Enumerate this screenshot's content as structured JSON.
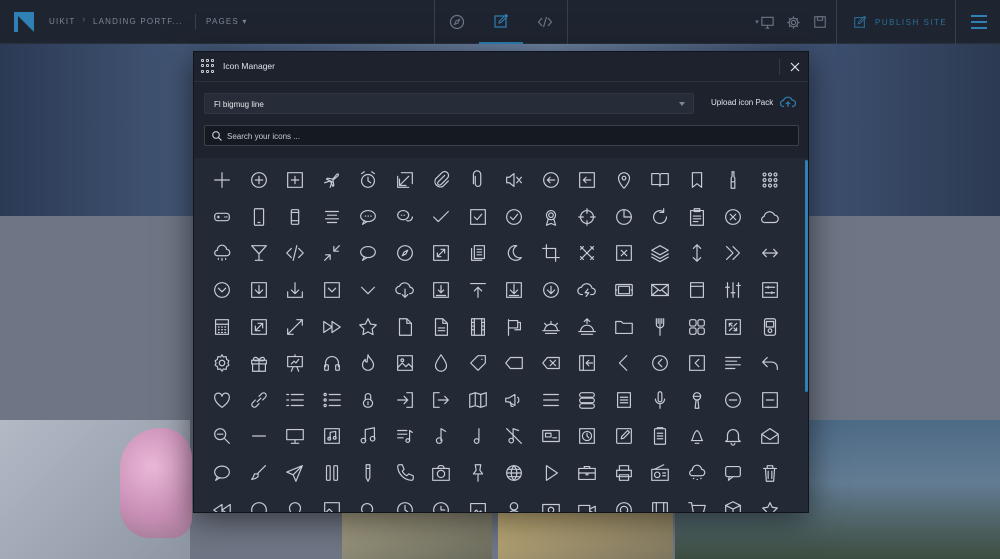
{
  "topbar": {
    "breadcrumb": [
      "UIKIT",
      "LANDING PORTF..."
    ],
    "pages_label": "PAGES",
    "publish_label": "PUBLISH SITE",
    "accent": "#2f80b5",
    "center_tabs": [
      "compass-icon",
      "edit-icon",
      "code-icon"
    ],
    "tools": [
      "device-icon",
      "gear-icon",
      "save-icon"
    ]
  },
  "modal": {
    "title": "Icon Manager",
    "pack_selected": "Fl bigmug line",
    "upload_label": "Upload icon Pack",
    "search_placeholder": "Search your icons ..."
  },
  "icons": [
    "plus",
    "plus-circle",
    "plus-square",
    "airplane",
    "alarm-clock",
    "arrow-down-left-square",
    "paperclip",
    "paperclip-alt",
    "mute",
    "arrow-left-circle",
    "arrow-left-square",
    "location-pin",
    "book-open",
    "bookmark",
    "bottle",
    "keypad",
    "gamepad",
    "mobile",
    "mobile-alt",
    "align-center",
    "chat-bubble",
    "chat-bubbles",
    "check",
    "check-square",
    "check-circle",
    "award",
    "crosshair",
    "pie-chart",
    "refresh",
    "clipboard",
    "close-circle",
    "cloud",
    "cloud-rain",
    "cocktail",
    "code",
    "collapse",
    "speech-bubble",
    "compass",
    "compress-square",
    "documents",
    "moon",
    "crop",
    "cross",
    "close-square",
    "layers",
    "arrow-up-down",
    "chevrons-right",
    "arrow-left-right",
    "chevron-down-circle",
    "download-square",
    "download-box",
    "chevron-down-square",
    "chevron-down",
    "cloud-download",
    "download-tray",
    "upload-bar",
    "download-frame",
    "arrow-down-circle",
    "cloud-lightning",
    "tv",
    "mail",
    "frame",
    "sliders",
    "sliders-box",
    "calculator",
    "expand",
    "expand-arrows",
    "fast-forward",
    "star",
    "file",
    "file-alt",
    "film",
    "flag",
    "sunset",
    "sunrise",
    "folder",
    "fork",
    "grid",
    "fullscreen",
    "ipod",
    "gear",
    "gift",
    "presentation",
    "headphones",
    "flame",
    "image",
    "drop",
    "tag",
    "tag-left",
    "delete-left",
    "login",
    "chevron-left",
    "chevron-left-circle",
    "chevron-left-square",
    "align-left",
    "undo",
    "heart",
    "link",
    "list",
    "list-bullets",
    "lock",
    "sign-in",
    "sign-out",
    "map",
    "megaphone",
    "menu",
    "database",
    "note",
    "microphone",
    "microphone-alt",
    "minus-circle",
    "minus-square",
    "zoom-out",
    "minus",
    "monitor",
    "music-square",
    "music-notes",
    "playlist",
    "music-note",
    "music-note-alt",
    "music-off",
    "card",
    "clock-square",
    "pencil",
    "clipboard-list",
    "bell-alt",
    "bell",
    "envelope-open",
    "speech",
    "brush",
    "send",
    "pause",
    "pencil-alt",
    "phone",
    "camera",
    "pin",
    "globe",
    "play",
    "briefcase",
    "printer",
    "radio",
    "cloud-snow",
    "message-square",
    "trash",
    "rewind",
    "circle",
    "location",
    "picture",
    "search",
    "clock",
    "clock-alt",
    "image-frame",
    "user",
    "photo",
    "video",
    "target",
    "film-alt",
    "cart",
    "box",
    "star-alt"
  ]
}
